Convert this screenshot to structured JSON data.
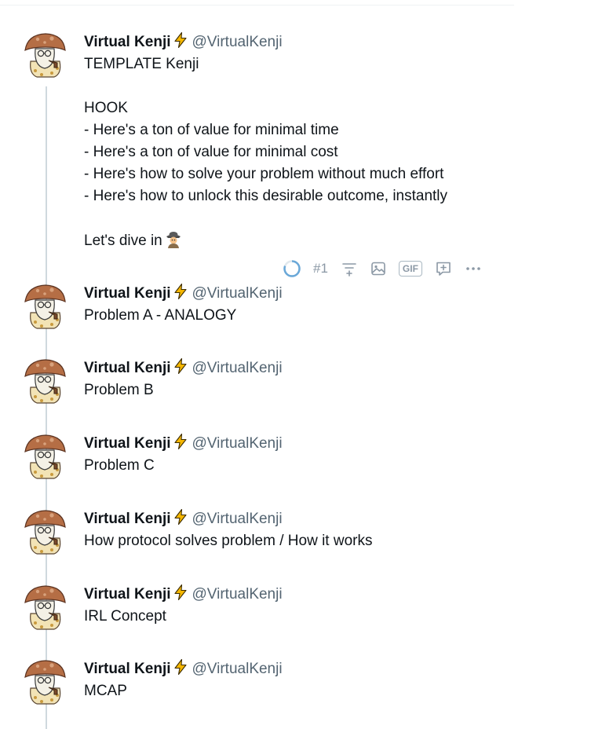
{
  "author": {
    "display_name": "Virtual Kenji",
    "handle": "@VirtualKenji",
    "badge_icon": "lightning-bolt-icon"
  },
  "tweets": [
    {
      "body": "TEMPLATE Kenji\n\nHOOK\n- Here's a ton of value for minimal time\n- Here's a ton of value for minimal cost\n- Here's how to solve your problem without much effort\n- Here's how to unlock this desirable outcome, instantly\n\nLet's dive in",
      "emoji": "detective-emoji"
    },
    {
      "body": "Problem A - ANALOGY"
    },
    {
      "body": "Problem B"
    },
    {
      "body": "Problem C"
    },
    {
      "body": "How protocol solves problem / How it works"
    },
    {
      "body": "IRL Concept"
    },
    {
      "body": "MCAP"
    }
  ],
  "composer_toolbar": {
    "counter": "#1",
    "gif_label": "GIF",
    "icons": [
      "progress-ring-icon",
      "poll-icon",
      "image-icon",
      "gif-button",
      "add-tweet-icon",
      "more-icon"
    ]
  },
  "colors": {
    "text": "#0f1419",
    "secondary": "#536471",
    "thread_line": "#cfd9de",
    "progress_ring": "#1d9bf0",
    "bolt": "#f5b700"
  }
}
